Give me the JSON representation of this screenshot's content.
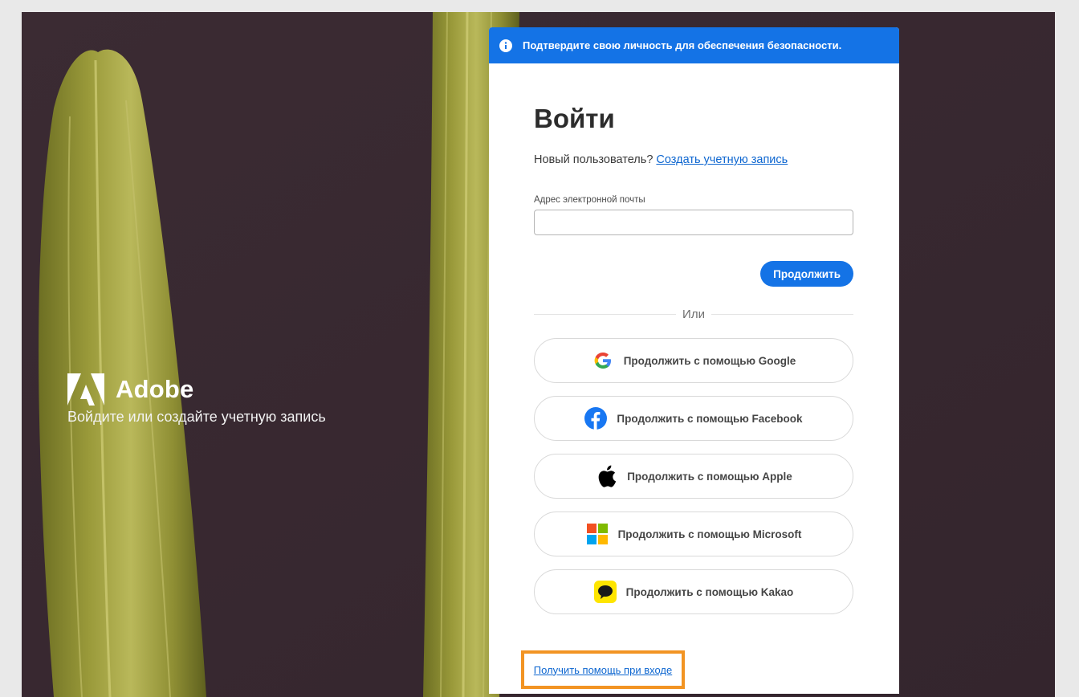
{
  "brand": {
    "name": "Adobe",
    "tagline": "Войдите или создайте учетную запись"
  },
  "banner": {
    "text": "Подтвердите свою личность для обеспечения безопасности."
  },
  "signin": {
    "title": "Войти",
    "new_user_text": "Новый пользователь?",
    "create_account_link": "Создать учетную запись",
    "email_label": "Адрес электронной почты",
    "email_value": "",
    "continue_label": "Продолжить",
    "or_label": "Или"
  },
  "social": {
    "google": "Продолжить с помощью Google",
    "facebook": "Продолжить с помощью Facebook",
    "apple": "Продолжить с помощью Apple",
    "microsoft": "Продолжить с помощью Microsoft",
    "kakao": "Продолжить с помощью Kakao"
  },
  "help_link": "Получить помощь при входе",
  "colors": {
    "accent": "#1473e6",
    "highlight": "#f29423",
    "background": "#3a2a32"
  }
}
